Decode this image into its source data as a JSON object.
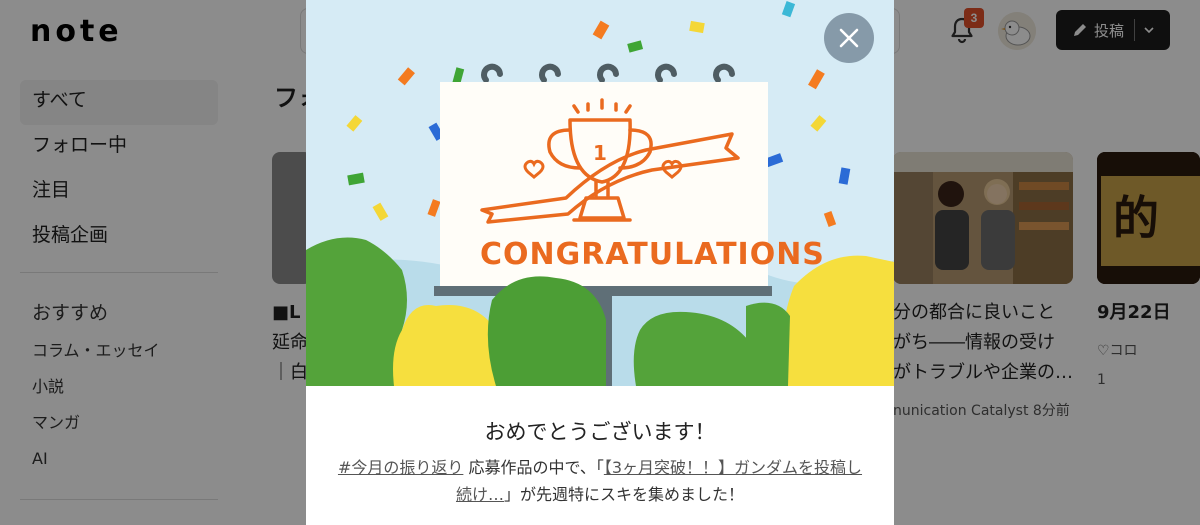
{
  "header": {
    "logo": "note",
    "notification_count": "3",
    "post_button_label": "投稿"
  },
  "sidebar": {
    "items": [
      {
        "label": "すべて",
        "active": true
      },
      {
        "label": "フォロー中"
      },
      {
        "label": "注目"
      },
      {
        "label": "投稿企画"
      }
    ],
    "recommend_title": "おすすめ",
    "categories": [
      "コラム・エッセイ",
      "小説",
      "マンガ",
      "AI"
    ]
  },
  "main": {
    "section_title": "フォ",
    "cards": [
      {
        "title_line1": "■L",
        "title_line2": "延命",
        "title_line3": "｜白"
      },
      {
        "title_line1": "分の都合に良いこと",
        "title_line2": "がち――情報の受け",
        "title_line3": "がトラブルや企業の…",
        "author": "nunication Catalyst",
        "time": "8分前"
      },
      {
        "title_line1": "9月22日",
        "likes_partial": "♡コロ",
        "like_count": "1"
      }
    ]
  },
  "modal": {
    "art_text": "CONGRATULATIONS",
    "trophy_number": "1",
    "heading": "おめでとうございます！",
    "hashtag": "#今月の振り返り",
    "text_1": "応募作品の中で、「",
    "article_link": "【3ヶ月突破！！】ガンダムを投稿し続け…",
    "text_2": "」が先週特にスキを集めました！"
  },
  "colors": {
    "accent": "#e8601c",
    "sky": "#d6ebf5",
    "badge": "#e2502b",
    "post_button": "#1c1c1c"
  }
}
